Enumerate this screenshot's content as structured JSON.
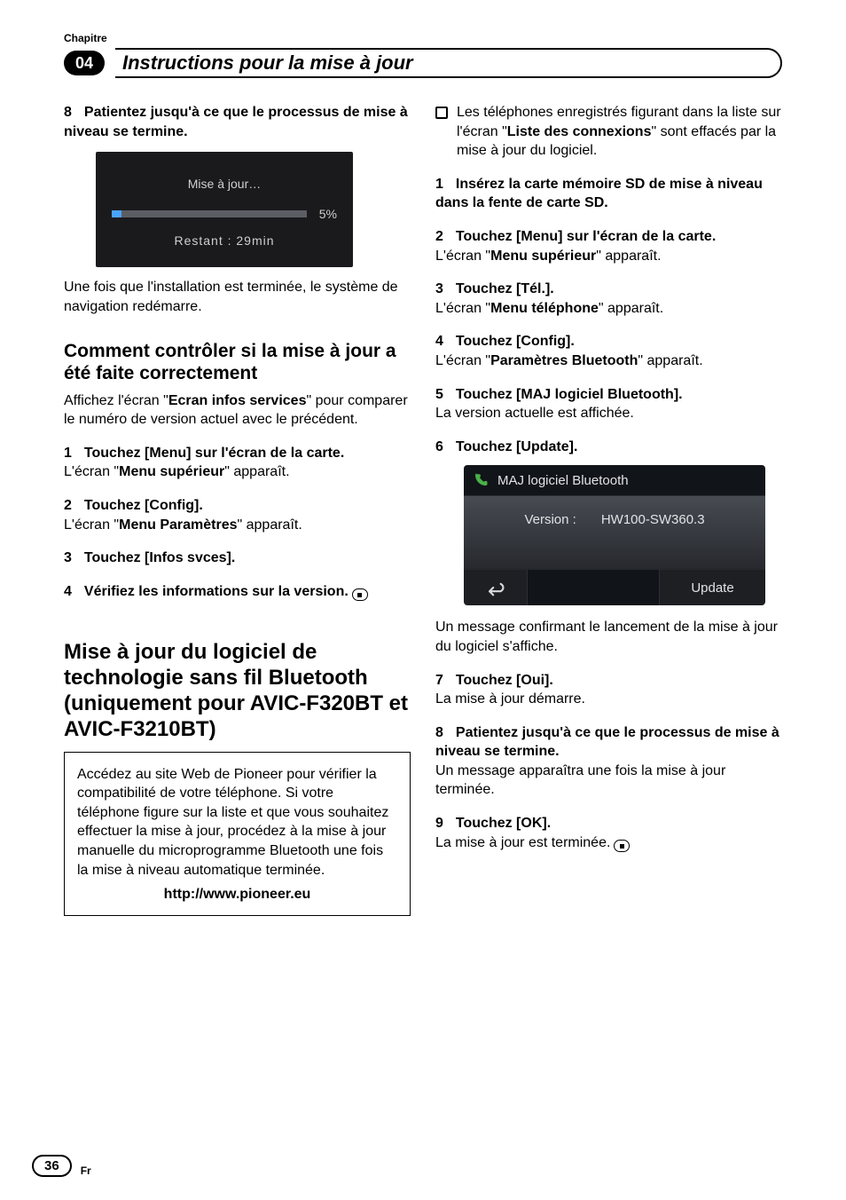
{
  "header": {
    "chapitre_label": "Chapitre",
    "chapter_number": "04",
    "chapter_title": "Instructions pour la mise à jour"
  },
  "left": {
    "step8": {
      "num": "8",
      "bold": "Patientez jusqu'à ce que le processus de mise à niveau se termine."
    },
    "screen1": {
      "title": "Mise à jour…",
      "percent": "5%",
      "remaining": "Restant  :  29min"
    },
    "after_screen1": "Une fois que l'installation est terminée, le système de navigation redémarre.",
    "h_check": "Comment contrôler si la mise à jour a été faite correctement",
    "check_intro_a": "Affichez l'écran \"",
    "check_intro_b": "Ecran infos services",
    "check_intro_c": "\" pour comparer le numéro de version actuel avec le précédent.",
    "c1": {
      "num": "1",
      "bold": "Touchez [Menu] sur l'écran de la carte.",
      "sub_a": "L'écran \"",
      "sub_b": "Menu supérieur",
      "sub_c": "\" apparaît."
    },
    "c2": {
      "num": "2",
      "bold": "Touchez [Config].",
      "sub_a": "L'écran \"",
      "sub_b": "Menu Paramètres",
      "sub_c": "\" apparaît."
    },
    "c3": {
      "num": "3",
      "bold": "Touchez [Infos svces]."
    },
    "c4": {
      "num": "4",
      "bold": "Vérifiez les informations sur la version."
    },
    "h_bt": "Mise à jour du logiciel de technologie sans fil Bluetooth (uniquement pour AVIC-F320BT et AVIC-F3210BT)",
    "box_text": "Accédez au site Web de Pioneer pour vérifier la compatibilité de votre téléphone. Si votre téléphone figure sur la liste et que vous souhaitez effectuer la mise à jour, procédez à la mise à jour manuelle du microprogramme Bluetooth une fois la mise à niveau automatique terminée.",
    "box_url": "http://www.pioneer.eu"
  },
  "right": {
    "bullet_a": "Les téléphones enregistrés figurant dans la liste sur l'écran \"",
    "bullet_b": "Liste des connexions",
    "bullet_c": "\" sont effacés par la mise à jour du logiciel.",
    "r1": {
      "num": "1",
      "bold": "Insérez la carte mémoire SD de mise à niveau dans la fente de carte SD."
    },
    "r2": {
      "num": "2",
      "bold": "Touchez [Menu] sur l'écran de la carte.",
      "sub_a": "L'écran \"",
      "sub_b": "Menu supérieur",
      "sub_c": "\" apparaît."
    },
    "r3": {
      "num": "3",
      "bold": "Touchez [Tél.].",
      "sub_a": "L'écran \"",
      "sub_b": "Menu téléphone",
      "sub_c": "\" apparaît."
    },
    "r4": {
      "num": "4",
      "bold": "Touchez [Config].",
      "sub_a": "L'écran \"",
      "sub_b": "Paramètres Bluetooth",
      "sub_c": "\" apparaît."
    },
    "r5": {
      "num": "5",
      "bold": "Touchez [MAJ logiciel Bluetooth].",
      "sub": "La version actuelle est affichée."
    },
    "r6": {
      "num": "6",
      "bold": "Touchez [Update]."
    },
    "bt_screen": {
      "title": "MAJ logiciel Bluetooth",
      "version_label": "Version :",
      "version_value": "HW100-SW360.3",
      "update_button": "Update"
    },
    "after_bt": "Un message confirmant le lancement de la mise à jour du logiciel s'affiche.",
    "r7": {
      "num": "7",
      "bold": "Touchez [Oui].",
      "sub": "La mise à jour démarre."
    },
    "r8": {
      "num": "8",
      "bold": "Patientez jusqu'à ce que le processus de mise à niveau se termine.",
      "sub": "Un message apparaîtra une fois la mise à jour terminée."
    },
    "r9": {
      "num": "9",
      "bold": "Touchez [OK].",
      "sub": "La mise à jour est terminée."
    }
  },
  "footer": {
    "page": "36",
    "lang": "Fr"
  }
}
